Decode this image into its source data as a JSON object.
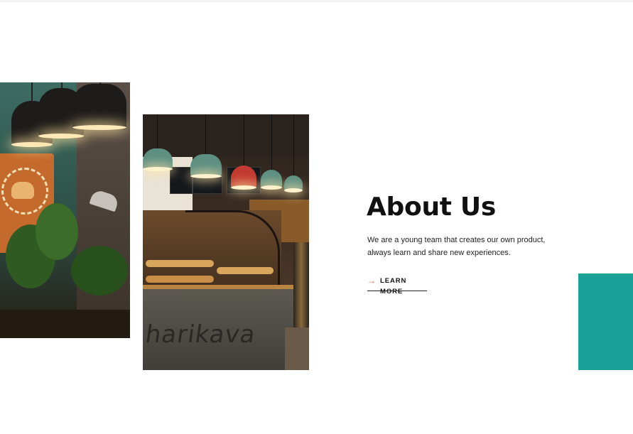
{
  "about": {
    "title": "About Us",
    "description_lines": [
      "We are a young team that creates our own product,",
      "always learn and share new experiences."
    ],
    "cta_label": "LEARN MORE",
    "cta_icon": "arrow-right-icon"
  },
  "photos": {
    "interior_name": "cafe-interior-photo",
    "counter_name": "bakery-counter-photo",
    "counter_sign_text": "harikava"
  },
  "colors": {
    "accent_teal": "#1aa198",
    "cta_arrow": "#d9534f",
    "text": "#111111"
  }
}
